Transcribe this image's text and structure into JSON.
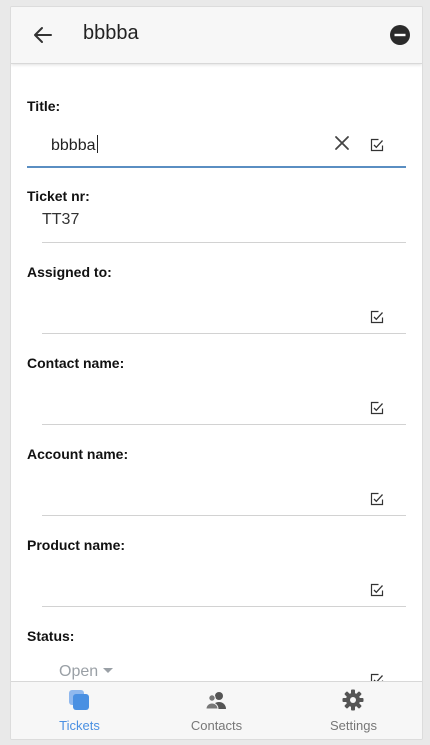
{
  "header": {
    "title": "bbbba"
  },
  "form": {
    "title_label": "Title:",
    "title_value": "bbbba",
    "ticket_nr_label": "Ticket nr:",
    "ticket_nr_value": "TT37",
    "assigned_label": "Assigned to:",
    "contact_label": "Contact name:",
    "account_label": "Account name:",
    "product_label": "Product name:",
    "status_label": "Status:",
    "status_value": "Open"
  },
  "tabs": [
    {
      "label": "Tickets",
      "icon": "tickets-icon",
      "active": true
    },
    {
      "label": "Contacts",
      "icon": "contacts-icon",
      "active": false
    },
    {
      "label": "Settings",
      "icon": "gear-icon",
      "active": false
    }
  ],
  "colors": {
    "accent": "#4a90e2",
    "underline_focus": "#5a8ec2",
    "muted": "#9aa0a6"
  }
}
